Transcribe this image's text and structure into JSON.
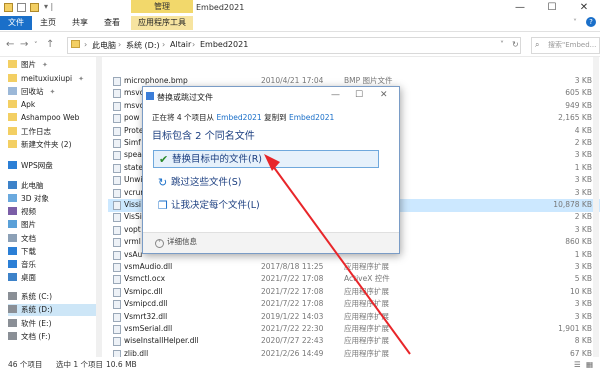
{
  "window": {
    "title": "Embed2021",
    "manage_tab": "管理",
    "controls": {
      "minimize": "—",
      "maximize": "☐",
      "close": "✕"
    }
  },
  "ribbon": {
    "tabs": [
      "文件",
      "主页",
      "共享",
      "查看"
    ],
    "app_tab": "应用程序工具"
  },
  "address": {
    "crumbs": [
      "此电脑",
      "系统 (D:)",
      "Altair",
      "Embed2021"
    ],
    "search_placeholder": "搜索\"Embed..."
  },
  "nav": {
    "items": [
      {
        "label": "图片",
        "pinned": true,
        "icon": "folder-icon"
      },
      {
        "label": "meituxiuxiupi",
        "pinned": true,
        "icon": "folder-icon"
      },
      {
        "label": "回收站",
        "pinned": true,
        "icon": "recycle-bin-icon"
      },
      {
        "label": "Apk",
        "pinned": false,
        "icon": "folder-icon"
      },
      {
        "label": "Ashampoo Web",
        "pinned": false,
        "icon": "folder-icon"
      },
      {
        "label": "工作日志",
        "pinned": false,
        "icon": "folder-icon"
      },
      {
        "label": "新建文件夹 (2)",
        "pinned": false,
        "icon": "folder-icon"
      },
      {
        "label": "WPS网盘",
        "pinned": false,
        "icon": "cloud-icon"
      },
      {
        "label": "此电脑",
        "pinned": false,
        "icon": "computer-icon"
      },
      {
        "label": "3D 对象",
        "pinned": false,
        "icon": "cube-icon"
      },
      {
        "label": "视频",
        "pinned": false,
        "icon": "video-icon"
      },
      {
        "label": "图片",
        "pinned": false,
        "icon": "picture-icon"
      },
      {
        "label": "文档",
        "pinned": false,
        "icon": "document-icon"
      },
      {
        "label": "下载",
        "pinned": false,
        "icon": "download-icon"
      },
      {
        "label": "音乐",
        "pinned": false,
        "icon": "music-icon"
      },
      {
        "label": "桌面",
        "pinned": false,
        "icon": "desktop-icon"
      },
      {
        "label": "系统 (C:)",
        "pinned": false,
        "icon": "drive-icon"
      },
      {
        "label": "系统 (D:)",
        "pinned": false,
        "icon": "drive-icon"
      },
      {
        "label": "软件 (E:)",
        "pinned": false,
        "icon": "drive-icon"
      },
      {
        "label": "文档 (F:)",
        "pinned": false,
        "icon": "drive-icon"
      }
    ]
  },
  "files": [
    {
      "name": "microphone.bmp",
      "date": "2010/4/21 17:04",
      "type": "BMP 图片文件",
      "size": "3 KB"
    },
    {
      "name": "msvc",
      "date": "",
      "type": "",
      "size": "605 KB"
    },
    {
      "name": "msvc",
      "date": "",
      "type": "",
      "size": "949 KB"
    },
    {
      "name": "pow",
      "date": "",
      "type": "",
      "size": "2,165 KB"
    },
    {
      "name": "Prote",
      "date": "",
      "type": "",
      "size": "4 KB"
    },
    {
      "name": "Simf",
      "date": "",
      "type": "",
      "size": "2 KB"
    },
    {
      "name": "spea",
      "date": "",
      "type": "",
      "size": "3 KB"
    },
    {
      "name": "state",
      "date": "",
      "type": "",
      "size": "1 KB"
    },
    {
      "name": "Unwi",
      "date": "",
      "type": "",
      "size": "3 KB"
    },
    {
      "name": "vcrun",
      "date": "",
      "type": "",
      "size": "3 KB"
    },
    {
      "name": "Vissi",
      "date": "",
      "type": "",
      "size": "10,878 KB"
    },
    {
      "name": "VisSi",
      "date": "",
      "type": "",
      "size": "2 KB"
    },
    {
      "name": "vopt",
      "date": "",
      "type": "",
      "size": "3 KB"
    },
    {
      "name": "vrml",
      "date": "",
      "type": "",
      "size": "860 KB"
    },
    {
      "name": "vsAu",
      "date": "",
      "type": "",
      "size": "1 KB"
    },
    {
      "name": "vsmAudio.dll",
      "date": "2017/8/18 11:25",
      "type": "应用程序扩展",
      "size": "3 KB"
    },
    {
      "name": "Vsmctl.ocx",
      "date": "2021/7/22 17:08",
      "type": "ActiveX 控件",
      "size": "5 KB"
    },
    {
      "name": "Vsmipc.dll",
      "date": "2021/7/22 17:08",
      "type": "应用程序扩展",
      "size": "10 KB"
    },
    {
      "name": "Vsmipcd.dll",
      "date": "2021/7/22 17:08",
      "type": "应用程序扩展",
      "size": "3 KB"
    },
    {
      "name": "Vsmrt32.dll",
      "date": "2019/1/22 14:03",
      "type": "应用程序扩展",
      "size": "3 KB"
    },
    {
      "name": "vsmSerial.dll",
      "date": "2021/7/22 22:30",
      "type": "应用程序扩展",
      "size": "1,901 KB"
    },
    {
      "name": "wiseInstallHelper.dll",
      "date": "2020/7/27 22:43",
      "type": "应用程序扩展",
      "size": "8 KB"
    },
    {
      "name": "zlib.dll",
      "date": "2021/2/26 14:49",
      "type": "应用程序扩展",
      "size": "67 KB"
    }
  ],
  "status": {
    "count": "46 个项目",
    "selected": "选中 1 个项目",
    "size": "10.6 MB"
  },
  "dialog": {
    "title": "替换或跳过文件",
    "line_prefix": "正在将 4 个项目从",
    "from": "Embed2021",
    "mid": "复制到",
    "to": "Embed2021",
    "heading": "目标包含 2 个同名文件",
    "options": [
      {
        "label": "替换目标中的文件(R)",
        "icon": "check-icon"
      },
      {
        "label": "跳过这些文件(S)",
        "icon": "skip-icon"
      },
      {
        "label": "让我决定每个文件(L)",
        "icon": "decide-icon"
      }
    ],
    "more": "详细信息",
    "controls": {
      "minimize": "—",
      "maximize": "☐",
      "close": "✕"
    }
  },
  "colors": {
    "accent": "#1a6fc9",
    "arrow": "#e8262a",
    "selection": "#cce8ff"
  }
}
